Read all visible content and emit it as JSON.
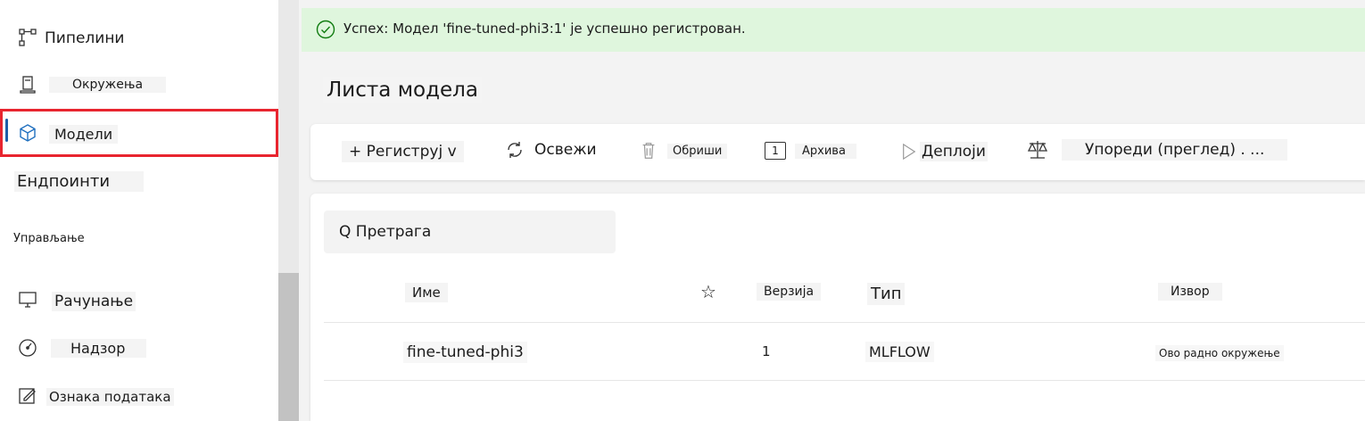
{
  "sidebar": {
    "items": [
      {
        "label": "Пипелини",
        "icon": "pipeline-icon"
      },
      {
        "label": "Окружења",
        "icon": "environment-icon"
      },
      {
        "label": "Модели",
        "icon": "cube-icon",
        "selected": true
      },
      {
        "label": "Ендпоинти",
        "icon": "endpoint-icon"
      },
      {
        "label": "Рачунање",
        "icon": "compute-icon"
      },
      {
        "label": "Надзор",
        "icon": "monitor-gauge-icon"
      },
      {
        "label": "Ознака података",
        "icon": "data-label-icon"
      }
    ],
    "section_header": "Управљање"
  },
  "banner": {
    "text": "Успех: Модел 'fine-tuned-phi3:1' је успешно регистрован.",
    "color": "#dff6dd",
    "icon": "check-circle-icon"
  },
  "main": {
    "title": "Листа модела",
    "toolbar": {
      "register": "+ Региструј v",
      "refresh": "Освежи",
      "delete": "Обриши",
      "archive_icon_text": "1",
      "archive": "Архива",
      "deploy": "Деплоји",
      "compare": "Упореди (преглед) . ..."
    },
    "search": {
      "text": "Q Претрага"
    },
    "table": {
      "headers": {
        "name": "Име",
        "star": "☆",
        "version": "Верзија",
        "type": "Тип",
        "source": "Извор"
      },
      "rows": [
        {
          "name": "fine-tuned-phi3",
          "version": "1",
          "type": "MLFLOW",
          "source": "Ово радно окружење"
        }
      ]
    }
  },
  "colors": {
    "selected_border": "#e8252f",
    "selection_bar": "#1f5ea8",
    "success_icon": "#107c10"
  }
}
